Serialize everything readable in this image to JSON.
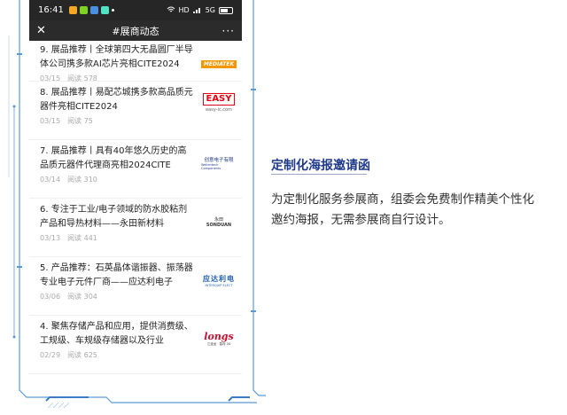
{
  "status_bar": {
    "time": "16:41",
    "network": "HD",
    "signal": "5G"
  },
  "nav": {
    "close_icon": "✕",
    "title": "#展商动态",
    "more_icon": "···"
  },
  "feed": [
    {
      "title": "9. 展品推荐丨全球第四大无晶圆厂半导体公司携多款AI芯片亮相CITE2024",
      "date": "03/15",
      "views": "阅读 578",
      "thumb_text": "MEDIATEK",
      "thumb_sub": ""
    },
    {
      "title": "8. 展品推荐丨易配芯城携多款高品质元器件亮相CITE2024",
      "date": "03/15",
      "views": "阅读 75",
      "thumb_text": "EASY",
      "thumb_sub": "easy-ic.com"
    },
    {
      "title": "7. 展品推荐丨具有40年悠久历史的高品质元器件代理商亮相2024CITE",
      "date": "03/14",
      "views": "阅读 310",
      "thumb_text": "创意电子有限",
      "thumb_sub": "Wellentech Components"
    },
    {
      "title": "6. 专注于工业/电子领域的防水胶粘剂产品和导热材料——永田新材料",
      "date": "03/13",
      "views": "阅读 441",
      "thumb_text": "永田",
      "thumb_sub": "SONDUAN"
    },
    {
      "title": "5. 产品推荐：石英晶体谐振器、振荡器专业电子元件厂商——应达利电子",
      "date": "03/06",
      "views": "阅读 304",
      "thumb_text": "应达利电",
      "thumb_sub": "INTERQUIP ELECT"
    },
    {
      "title": "4. 聚焦存储产品和应用，提供消费级、工规级、车规级存储器以及行业",
      "date": "02/29",
      "views": "阅读 625",
      "thumb_text": "longs",
      "thumb_sub": "江波龙 · 智存 34"
    }
  ],
  "panel": {
    "heading": "定制化海报邀请函",
    "body": "为定制化服务参展商，组委会免费制作精美个性化邀约海报，无需参展商自行设计。"
  },
  "colors": {
    "heading": "#1f3a8a",
    "frame": "#5b9bd5",
    "mediatek": "#f39800",
    "easy": "#e60012",
    "longsys": "#c8102e"
  }
}
